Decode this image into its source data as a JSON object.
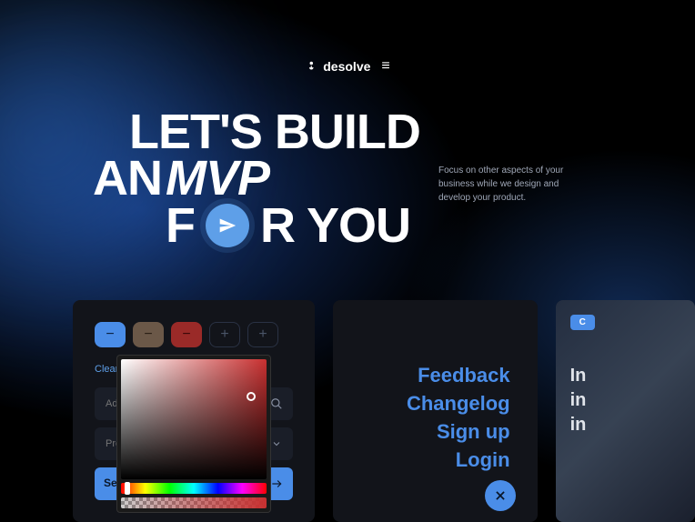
{
  "brand": "desolve",
  "hero": {
    "line1": "LET'S BUILD",
    "line2a": "AN",
    "line2b": "MVP",
    "line3a": "F",
    "line3b": "R YOU",
    "sub": "Focus on other aspects of your business while we design and develop your product."
  },
  "panel1": {
    "clear_all": "Clear all",
    "input1_placeholder": "Add t",
    "input2_placeholder": "Prefe",
    "search_label": "Sear"
  },
  "panel2": {
    "links": [
      "Feedback",
      "Changelog",
      "Sign up",
      "Login"
    ]
  },
  "panel3": {
    "badge": "C",
    "text_lines": [
      "In",
      "in",
      "in"
    ]
  }
}
